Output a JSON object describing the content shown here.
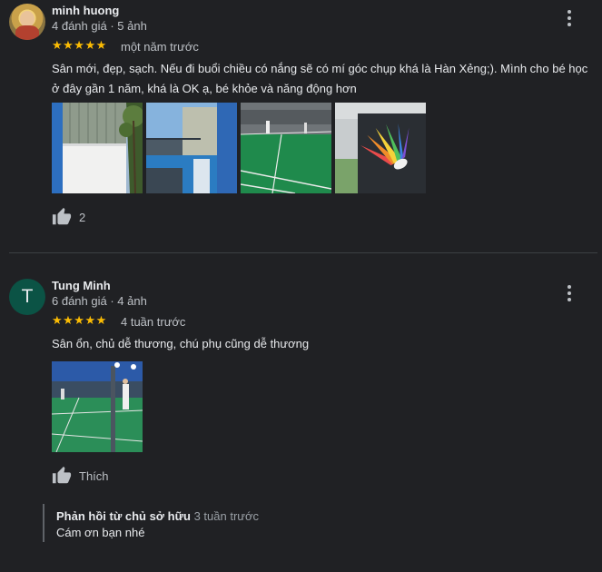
{
  "reviews": [
    {
      "author": "minh huong",
      "meta": "4 đánh giá · 5 ảnh",
      "stars": "★★★★★",
      "date": "một năm trước",
      "text_line1": "Sân mới, đẹp, sạch. Nếu đi buổi chiều có nắng sẽ có mí góc chụp khá là Hàn Xẻng;). Mình cho bé học",
      "text_line2": "ở đây gần 1 năm, khá là OK ạ, bé khỏe và năng động hơn",
      "likes": "2"
    },
    {
      "author": "Tung Minh",
      "avatar_letter": "T",
      "meta": "6 đánh giá · 4 ảnh",
      "stars": "★★★★★",
      "date": "4 tuần trước",
      "text_line1": "Sân ổn, chủ dễ thương, chú phụ cũng dễ thương",
      "like_label": "Thích",
      "owner_reply": {
        "title": "Phản hồi từ chủ sở hữu",
        "date": "3 tuần trước",
        "text": "Cám ơn bạn nhé"
      }
    }
  ],
  "icons": {
    "menu": "more-vert-icon",
    "like": "thumb-up-icon"
  },
  "colors": {
    "background": "#202124",
    "star": "#fbbc04",
    "avatar_t": "#0b5345"
  }
}
